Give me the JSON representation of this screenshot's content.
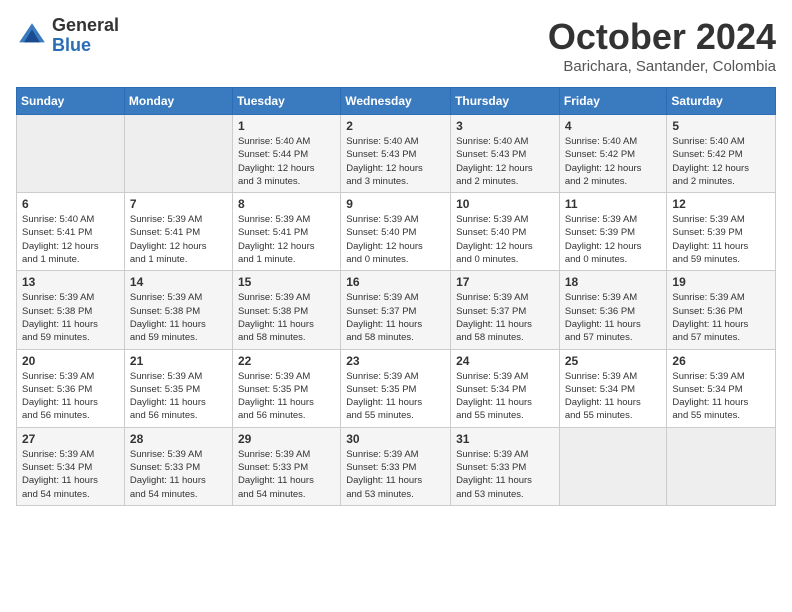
{
  "header": {
    "logo_general": "General",
    "logo_blue": "Blue",
    "month_title": "October 2024",
    "location": "Barichara, Santander, Colombia"
  },
  "days_of_week": [
    "Sunday",
    "Monday",
    "Tuesday",
    "Wednesday",
    "Thursday",
    "Friday",
    "Saturday"
  ],
  "weeks": [
    [
      {
        "day": "",
        "info": ""
      },
      {
        "day": "",
        "info": ""
      },
      {
        "day": "1",
        "info": "Sunrise: 5:40 AM\nSunset: 5:44 PM\nDaylight: 12 hours\nand 3 minutes."
      },
      {
        "day": "2",
        "info": "Sunrise: 5:40 AM\nSunset: 5:43 PM\nDaylight: 12 hours\nand 3 minutes."
      },
      {
        "day": "3",
        "info": "Sunrise: 5:40 AM\nSunset: 5:43 PM\nDaylight: 12 hours\nand 2 minutes."
      },
      {
        "day": "4",
        "info": "Sunrise: 5:40 AM\nSunset: 5:42 PM\nDaylight: 12 hours\nand 2 minutes."
      },
      {
        "day": "5",
        "info": "Sunrise: 5:40 AM\nSunset: 5:42 PM\nDaylight: 12 hours\nand 2 minutes."
      }
    ],
    [
      {
        "day": "6",
        "info": "Sunrise: 5:40 AM\nSunset: 5:41 PM\nDaylight: 12 hours\nand 1 minute."
      },
      {
        "day": "7",
        "info": "Sunrise: 5:39 AM\nSunset: 5:41 PM\nDaylight: 12 hours\nand 1 minute."
      },
      {
        "day": "8",
        "info": "Sunrise: 5:39 AM\nSunset: 5:41 PM\nDaylight: 12 hours\nand 1 minute."
      },
      {
        "day": "9",
        "info": "Sunrise: 5:39 AM\nSunset: 5:40 PM\nDaylight: 12 hours\nand 0 minutes."
      },
      {
        "day": "10",
        "info": "Sunrise: 5:39 AM\nSunset: 5:40 PM\nDaylight: 12 hours\nand 0 minutes."
      },
      {
        "day": "11",
        "info": "Sunrise: 5:39 AM\nSunset: 5:39 PM\nDaylight: 12 hours\nand 0 minutes."
      },
      {
        "day": "12",
        "info": "Sunrise: 5:39 AM\nSunset: 5:39 PM\nDaylight: 11 hours\nand 59 minutes."
      }
    ],
    [
      {
        "day": "13",
        "info": "Sunrise: 5:39 AM\nSunset: 5:38 PM\nDaylight: 11 hours\nand 59 minutes."
      },
      {
        "day": "14",
        "info": "Sunrise: 5:39 AM\nSunset: 5:38 PM\nDaylight: 11 hours\nand 59 minutes."
      },
      {
        "day": "15",
        "info": "Sunrise: 5:39 AM\nSunset: 5:38 PM\nDaylight: 11 hours\nand 58 minutes."
      },
      {
        "day": "16",
        "info": "Sunrise: 5:39 AM\nSunset: 5:37 PM\nDaylight: 11 hours\nand 58 minutes."
      },
      {
        "day": "17",
        "info": "Sunrise: 5:39 AM\nSunset: 5:37 PM\nDaylight: 11 hours\nand 58 minutes."
      },
      {
        "day": "18",
        "info": "Sunrise: 5:39 AM\nSunset: 5:36 PM\nDaylight: 11 hours\nand 57 minutes."
      },
      {
        "day": "19",
        "info": "Sunrise: 5:39 AM\nSunset: 5:36 PM\nDaylight: 11 hours\nand 57 minutes."
      }
    ],
    [
      {
        "day": "20",
        "info": "Sunrise: 5:39 AM\nSunset: 5:36 PM\nDaylight: 11 hours\nand 56 minutes."
      },
      {
        "day": "21",
        "info": "Sunrise: 5:39 AM\nSunset: 5:35 PM\nDaylight: 11 hours\nand 56 minutes."
      },
      {
        "day": "22",
        "info": "Sunrise: 5:39 AM\nSunset: 5:35 PM\nDaylight: 11 hours\nand 56 minutes."
      },
      {
        "day": "23",
        "info": "Sunrise: 5:39 AM\nSunset: 5:35 PM\nDaylight: 11 hours\nand 55 minutes."
      },
      {
        "day": "24",
        "info": "Sunrise: 5:39 AM\nSunset: 5:34 PM\nDaylight: 11 hours\nand 55 minutes."
      },
      {
        "day": "25",
        "info": "Sunrise: 5:39 AM\nSunset: 5:34 PM\nDaylight: 11 hours\nand 55 minutes."
      },
      {
        "day": "26",
        "info": "Sunrise: 5:39 AM\nSunset: 5:34 PM\nDaylight: 11 hours\nand 55 minutes."
      }
    ],
    [
      {
        "day": "27",
        "info": "Sunrise: 5:39 AM\nSunset: 5:34 PM\nDaylight: 11 hours\nand 54 minutes."
      },
      {
        "day": "28",
        "info": "Sunrise: 5:39 AM\nSunset: 5:33 PM\nDaylight: 11 hours\nand 54 minutes."
      },
      {
        "day": "29",
        "info": "Sunrise: 5:39 AM\nSunset: 5:33 PM\nDaylight: 11 hours\nand 54 minutes."
      },
      {
        "day": "30",
        "info": "Sunrise: 5:39 AM\nSunset: 5:33 PM\nDaylight: 11 hours\nand 53 minutes."
      },
      {
        "day": "31",
        "info": "Sunrise: 5:39 AM\nSunset: 5:33 PM\nDaylight: 11 hours\nand 53 minutes."
      },
      {
        "day": "",
        "info": ""
      },
      {
        "day": "",
        "info": ""
      }
    ]
  ]
}
